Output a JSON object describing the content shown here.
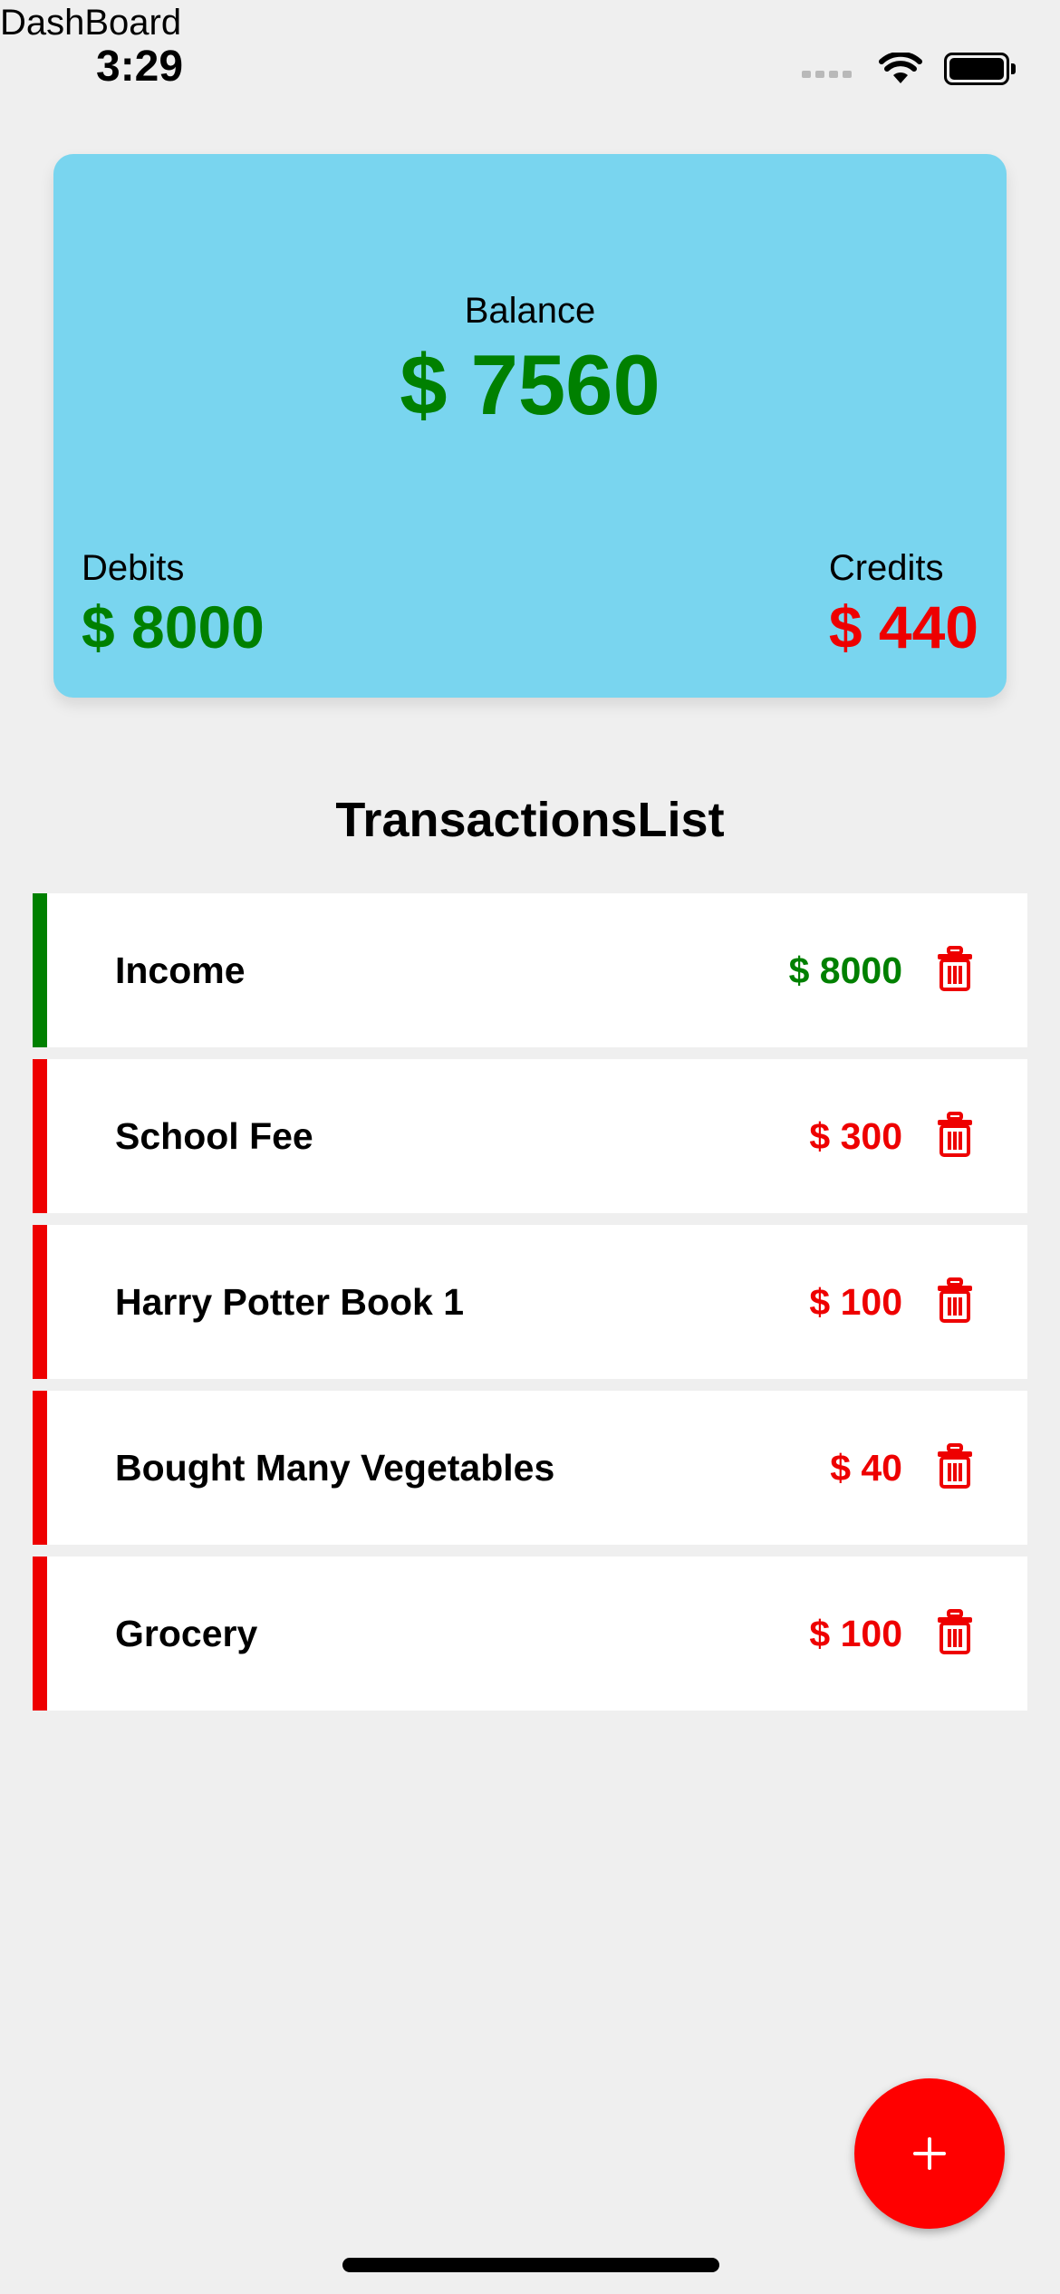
{
  "app": {
    "title": "DashBoard"
  },
  "status_bar": {
    "time": "3:29",
    "icons": [
      "signal-dots-icon",
      "wifi-icon",
      "battery-icon"
    ]
  },
  "summary": {
    "balance_label": "Balance",
    "balance_value": "$ 7560",
    "debits_label": "Debits",
    "debits_value": "$ 8000",
    "credits_label": "Credits",
    "credits_value": "$ 440"
  },
  "transactions": {
    "title": "TransactionsList",
    "items": [
      {
        "name": "Income",
        "amount": "$ 8000",
        "type": "income"
      },
      {
        "name": "School Fee",
        "amount": "$ 300",
        "type": "expense"
      },
      {
        "name": "Harry Potter Book 1",
        "amount": "$ 100",
        "type": "expense"
      },
      {
        "name": "Bought Many Vegetables",
        "amount": "$ 40",
        "type": "expense"
      },
      {
        "name": "Grocery",
        "amount": "$ 100",
        "type": "expense"
      }
    ],
    "delete_icon": "trash-icon"
  },
  "fab": {
    "icon": "plus-icon"
  },
  "colors": {
    "background": "#efefef",
    "card": "#79d5ef",
    "income": "#008000",
    "expense": "#ee0000",
    "fab": "#ff0000"
  }
}
